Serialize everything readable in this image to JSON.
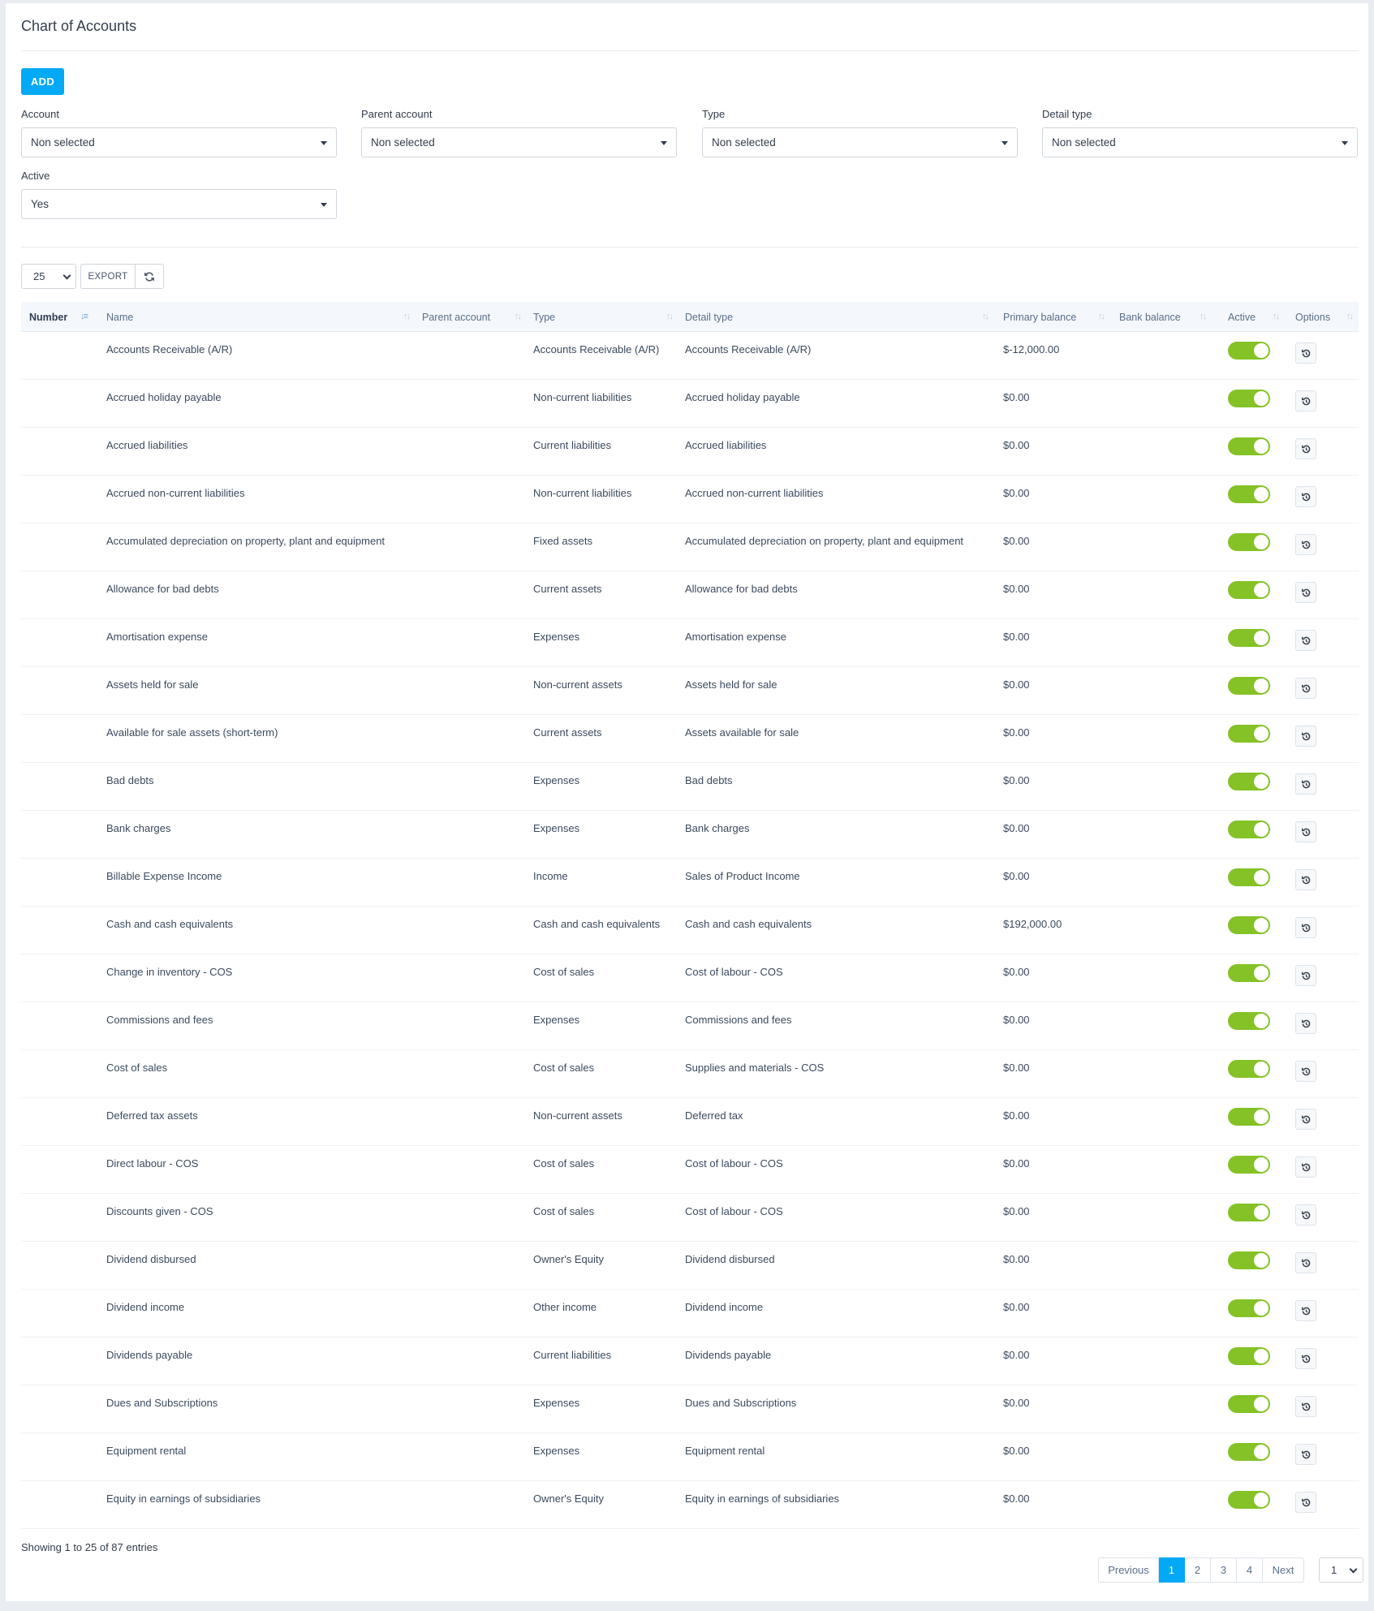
{
  "page": {
    "title": "Chart of Accounts"
  },
  "toolbar": {
    "add_label": "ADD",
    "export_label": "EXPORT",
    "page_length": "25"
  },
  "filters": [
    {
      "label": "Account",
      "value": "Non selected"
    },
    {
      "label": "Parent account",
      "value": "Non selected"
    },
    {
      "label": "Type",
      "value": "Non selected"
    },
    {
      "label": "Detail type",
      "value": "Non selected"
    },
    {
      "label": "Active",
      "value": "Yes"
    }
  ],
  "table": {
    "columns": [
      "Number",
      "Name",
      "Parent account",
      "Type",
      "Detail type",
      "Primary balance",
      "Bank balance",
      "Active",
      "Options"
    ],
    "sorted_column": "Number",
    "rows": [
      {
        "number": "",
        "name": "Accounts Receivable (A/R)",
        "parent": "",
        "type": "Accounts Receivable (A/R)",
        "detail": "Accounts Receivable (A/R)",
        "primary": "$-12,000.00",
        "bank": "",
        "active": true
      },
      {
        "number": "",
        "name": "Accrued holiday payable",
        "parent": "",
        "type": "Non-current liabilities",
        "detail": "Accrued holiday payable",
        "primary": "$0.00",
        "bank": "",
        "active": true
      },
      {
        "number": "",
        "name": "Accrued liabilities",
        "parent": "",
        "type": "Current liabilities",
        "detail": "Accrued liabilities",
        "primary": "$0.00",
        "bank": "",
        "active": true
      },
      {
        "number": "",
        "name": "Accrued non-current liabilities",
        "parent": "",
        "type": "Non-current liabilities",
        "detail": "Accrued non-current liabilities",
        "primary": "$0.00",
        "bank": "",
        "active": true
      },
      {
        "number": "",
        "name": "Accumulated depreciation on property, plant and equipment",
        "parent": "",
        "type": "Fixed assets",
        "detail": "Accumulated depreciation on property, plant and equipment",
        "primary": "$0.00",
        "bank": "",
        "active": true
      },
      {
        "number": "",
        "name": "Allowance for bad debts",
        "parent": "",
        "type": "Current assets",
        "detail": "Allowance for bad debts",
        "primary": "$0.00",
        "bank": "",
        "active": true
      },
      {
        "number": "",
        "name": "Amortisation expense",
        "parent": "",
        "type": "Expenses",
        "detail": "Amortisation expense",
        "primary": "$0.00",
        "bank": "",
        "active": true
      },
      {
        "number": "",
        "name": "Assets held for sale",
        "parent": "",
        "type": "Non-current assets",
        "detail": "Assets held for sale",
        "primary": "$0.00",
        "bank": "",
        "active": true
      },
      {
        "number": "",
        "name": "Available for sale assets (short-term)",
        "parent": "",
        "type": "Current assets",
        "detail": "Assets available for sale",
        "primary": "$0.00",
        "bank": "",
        "active": true
      },
      {
        "number": "",
        "name": "Bad debts",
        "parent": "",
        "type": "Expenses",
        "detail": "Bad debts",
        "primary": "$0.00",
        "bank": "",
        "active": true
      },
      {
        "number": "",
        "name": "Bank charges",
        "parent": "",
        "type": "Expenses",
        "detail": "Bank charges",
        "primary": "$0.00",
        "bank": "",
        "active": true
      },
      {
        "number": "",
        "name": "Billable Expense Income",
        "parent": "",
        "type": "Income",
        "detail": "Sales of Product Income",
        "primary": "$0.00",
        "bank": "",
        "active": true
      },
      {
        "number": "",
        "name": "Cash and cash equivalents",
        "parent": "",
        "type": "Cash and cash equivalents",
        "detail": "Cash and cash equivalents",
        "primary": "$192,000.00",
        "bank": "",
        "active": true
      },
      {
        "number": "",
        "name": "Change in inventory - COS",
        "parent": "",
        "type": "Cost of sales",
        "detail": "Cost of labour - COS",
        "primary": "$0.00",
        "bank": "",
        "active": true
      },
      {
        "number": "",
        "name": "Commissions and fees",
        "parent": "",
        "type": "Expenses",
        "detail": "Commissions and fees",
        "primary": "$0.00",
        "bank": "",
        "active": true
      },
      {
        "number": "",
        "name": "Cost of sales",
        "parent": "",
        "type": "Cost of sales",
        "detail": "Supplies and materials - COS",
        "primary": "$0.00",
        "bank": "",
        "active": true
      },
      {
        "number": "",
        "name": "Deferred tax assets",
        "parent": "",
        "type": "Non-current assets",
        "detail": "Deferred tax",
        "primary": "$0.00",
        "bank": "",
        "active": true
      },
      {
        "number": "",
        "name": "Direct labour - COS",
        "parent": "",
        "type": "Cost of sales",
        "detail": "Cost of labour - COS",
        "primary": "$0.00",
        "bank": "",
        "active": true
      },
      {
        "number": "",
        "name": "Discounts given - COS",
        "parent": "",
        "type": "Cost of sales",
        "detail": "Cost of labour - COS",
        "primary": "$0.00",
        "bank": "",
        "active": true
      },
      {
        "number": "",
        "name": "Dividend disbursed",
        "parent": "",
        "type": "Owner's Equity",
        "detail": "Dividend disbursed",
        "primary": "$0.00",
        "bank": "",
        "active": true
      },
      {
        "number": "",
        "name": "Dividend income",
        "parent": "",
        "type": "Other income",
        "detail": "Dividend income",
        "primary": "$0.00",
        "bank": "",
        "active": true
      },
      {
        "number": "",
        "name": "Dividends payable",
        "parent": "",
        "type": "Current liabilities",
        "detail": "Dividends payable",
        "primary": "$0.00",
        "bank": "",
        "active": true
      },
      {
        "number": "",
        "name": "Dues and Subscriptions",
        "parent": "",
        "type": "Expenses",
        "detail": "Dues and Subscriptions",
        "primary": "$0.00",
        "bank": "",
        "active": true
      },
      {
        "number": "",
        "name": "Equipment rental",
        "parent": "",
        "type": "Expenses",
        "detail": "Equipment rental",
        "primary": "$0.00",
        "bank": "",
        "active": true
      },
      {
        "number": "",
        "name": "Equity in earnings of subsidiaries",
        "parent": "",
        "type": "Owner's Equity",
        "detail": "Equity in earnings of subsidiaries",
        "primary": "$0.00",
        "bank": "",
        "active": true
      }
    ]
  },
  "footer": {
    "info": "Showing 1 to 25 of 87 entries",
    "previous": "Previous",
    "next": "Next",
    "pages": [
      "1",
      "2",
      "3",
      "4"
    ],
    "current_page": "1",
    "page_select": "1"
  },
  "colors": {
    "accent": "#03a9f4",
    "toggle_on": "#84c225"
  }
}
